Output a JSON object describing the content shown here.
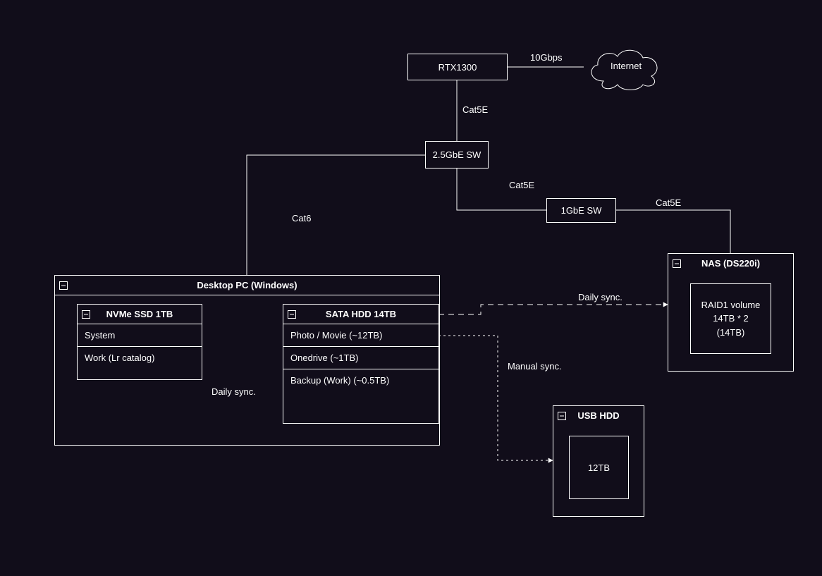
{
  "nodes": {
    "router": {
      "label": "RTX1300"
    },
    "internet": {
      "label": "Internet"
    },
    "switch25": {
      "label": "2.5GbE SW"
    },
    "switch1": {
      "label": "1GbE SW"
    },
    "desktop": {
      "title": "Desktop PC (Windows)",
      "nvme": {
        "title": "NVMe SSD 1TB",
        "rows": [
          "System",
          "Work (Lr catalog)"
        ]
      },
      "sata": {
        "title": "SATA HDD 14TB",
        "rows": [
          "Photo / Movie (~12TB)",
          "Onedrive (~1TB)",
          "Backup (Work) (~0.5TB)"
        ]
      }
    },
    "nas": {
      "title": "NAS (DS220i)",
      "volume": "RAID1 volume\n14TB * 2\n(14TB)"
    },
    "usbhdd": {
      "title": "USB HDD",
      "volume": "12TB"
    }
  },
  "edges": {
    "router_internet": "10Gbps",
    "router_switch25": "Cat5E",
    "switch25_desktop": "Cat6",
    "switch25_switch1": "Cat5E",
    "switch1_nas": "Cat5E",
    "nvme_sata": "Daily sync.",
    "sata_nas": "Daily sync.",
    "sata_usbhdd": "Manual sync."
  }
}
